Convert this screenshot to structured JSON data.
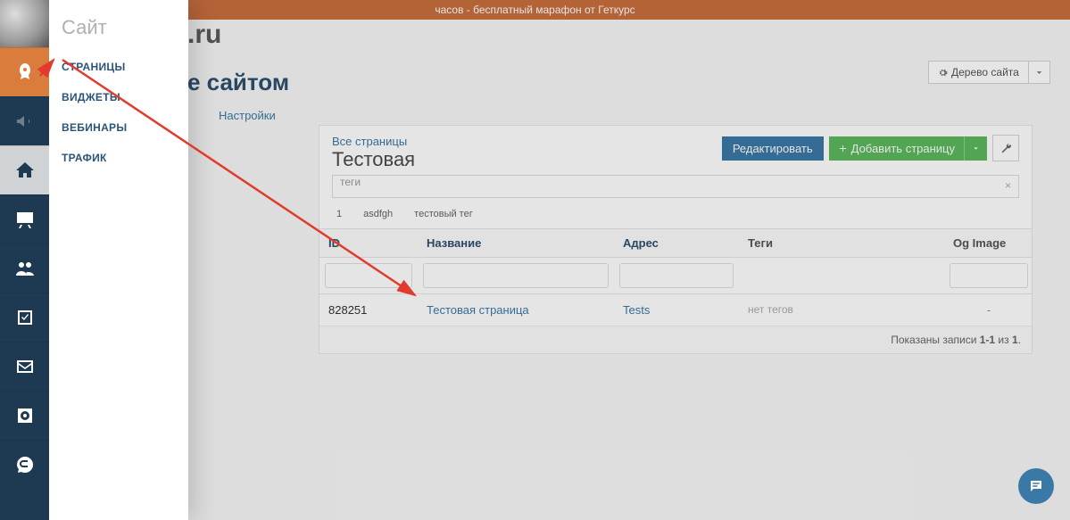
{
  "banner": "часов - бесплатный марафон от Геткурс",
  "bg_title": ".ru",
  "page_heading": "е сайтом",
  "tab_settings": "Настройки",
  "flyout": {
    "title": "Сайт",
    "items": [
      "СТРАНИЦЫ",
      "ВИДЖЕТЫ",
      "ВЕБИНАРЫ",
      "ТРАФИК"
    ]
  },
  "tree_button": "Дерево сайта",
  "card": {
    "crumb": "Все страницы",
    "title": "Тестовая",
    "edit": "Редактировать",
    "add": "Добавить страницу",
    "tag_placeholder": "теги",
    "chips": [
      "1",
      "asdfgh",
      "тестовый тег"
    ]
  },
  "table": {
    "headers": {
      "id": "ID",
      "name": "Название",
      "addr": "Адрес",
      "tags": "Теги",
      "og": "Og Image"
    },
    "row": {
      "id": "828251",
      "name": "Тестовая страница",
      "addr": "Tests",
      "tags": "нет тегов",
      "og": "-"
    },
    "footer_prefix": "Показаны записи ",
    "footer_range": "1-1",
    "footer_middle": " из ",
    "footer_total": "1",
    "footer_suffix": "."
  }
}
